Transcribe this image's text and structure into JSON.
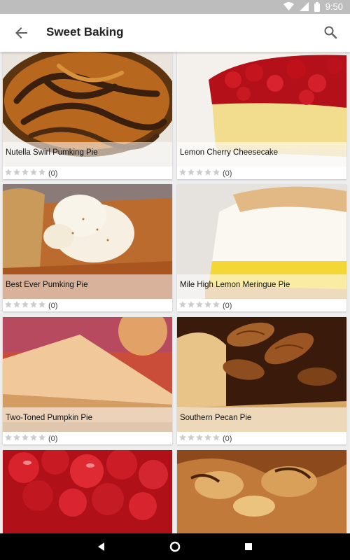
{
  "status_bar": {
    "time": "9:50",
    "icons": [
      "wifi-icon",
      "signal-icon",
      "battery-icon"
    ]
  },
  "app_bar": {
    "title": "Sweet Baking",
    "back_icon": "arrow-back-icon",
    "search_icon": "search-icon"
  },
  "recipes": [
    {
      "name": "Nutella Swirl Pumking Pie",
      "rating_count": "(0)",
      "stars": 0
    },
    {
      "name": "Lemon Cherry Cheesecake",
      "rating_count": "(0)",
      "stars": 0
    },
    {
      "name": "Best Ever Pumking Pie",
      "rating_count": "(0)",
      "stars": 0
    },
    {
      "name": "Mile High Lemon Meringue Pie",
      "rating_count": "(0)",
      "stars": 0
    },
    {
      "name": "Two-Toned Pumpkin Pie",
      "rating_count": "(0)",
      "stars": 0
    },
    {
      "name": "Southern Pecan Pie",
      "rating_count": "(0)",
      "stars": 0
    },
    {
      "name": "",
      "rating_count": "",
      "stars": 0
    },
    {
      "name": "",
      "rating_count": "",
      "stars": 0
    }
  ],
  "nav_bar": {
    "icons": [
      "nav-back-icon",
      "nav-home-icon",
      "nav-recents-icon"
    ]
  },
  "colors": {
    "accent": "#212121",
    "status_bar": "#bdbdbd",
    "star_empty": "#cccccc"
  }
}
